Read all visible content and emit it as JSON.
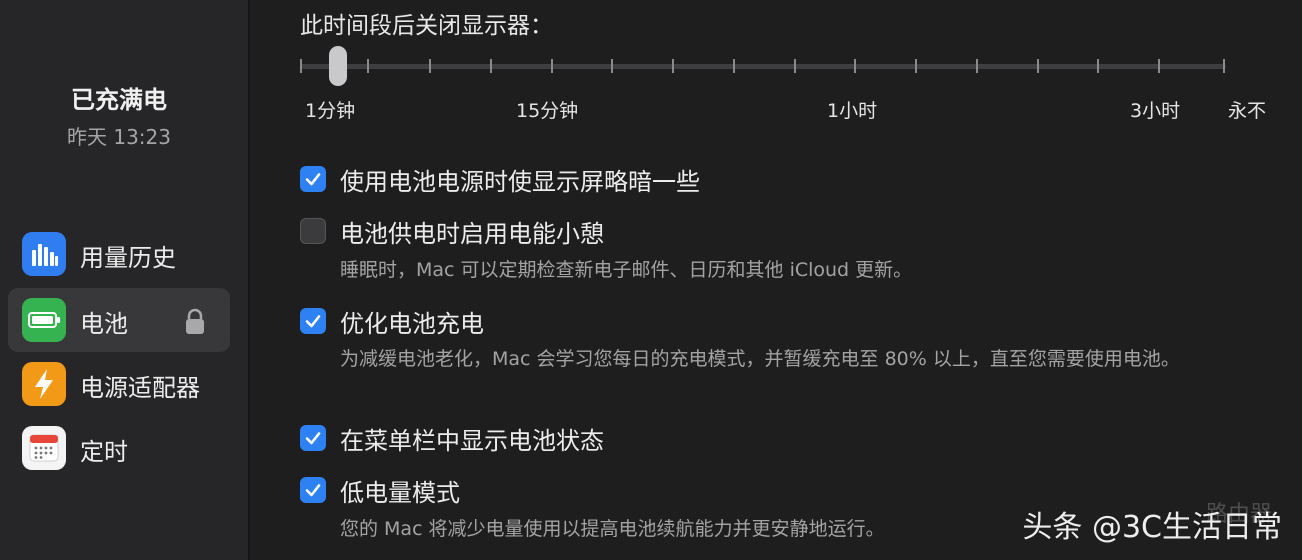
{
  "sidebar": {
    "status_title": "已充满电",
    "status_time": "昨天 13:23",
    "items": [
      {
        "label": "用量历史",
        "icon": "bar-chart-icon",
        "selected": false
      },
      {
        "label": "电池",
        "icon": "battery-icon",
        "selected": true
      },
      {
        "label": "电源适配器",
        "icon": "lightning-bolt-icon",
        "selected": false
      },
      {
        "label": "定时",
        "icon": "calendar-icon",
        "selected": false
      }
    ],
    "lock_icon": "lock-icon"
  },
  "display_off": {
    "title": "此时间段后关闭显示器：",
    "tick_labels": [
      "1分钟",
      "15分钟",
      "1小时",
      "3小时",
      "永不"
    ],
    "selected_value": "1分钟"
  },
  "options": [
    {
      "label": "使用电池电源时使显示屏略暗一些",
      "checked": true,
      "description": ""
    },
    {
      "label": "电池供电时启用电能小憩",
      "checked": false,
      "description": "睡眠时，Mac 可以定期检查新电子邮件、日历和其他 iCloud 更新。"
    },
    {
      "label": "优化电池充电",
      "checked": true,
      "description": "为减缓电池老化，Mac 会学习您每日的充电模式，并暂缓充电至 80% 以上，直至您需要使用电池。"
    },
    {
      "label": "在菜单栏中显示电池状态",
      "checked": true,
      "description": ""
    },
    {
      "label": "低电量模式",
      "checked": true,
      "description": "您的 Mac 将减少电量使用以提高电池续航能力并更安静地运行。"
    }
  ],
  "watermark": {
    "text": "头条 @3C生活日常",
    "faint_text": "路由器"
  },
  "colors": {
    "accent": "#2e81f3",
    "background": "#1e1e1e",
    "sidebar": "#262628"
  }
}
